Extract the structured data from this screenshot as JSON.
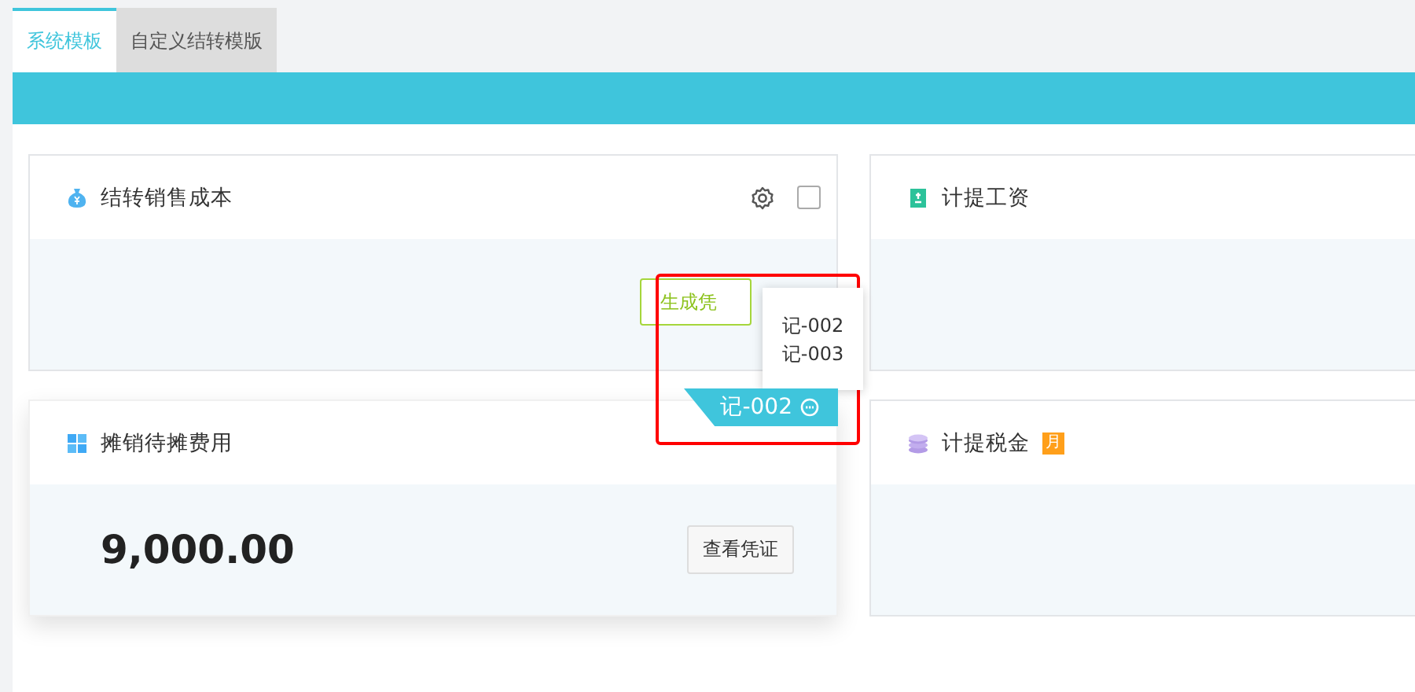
{
  "tabs": [
    {
      "label": "系统模板",
      "selected": true
    },
    {
      "label": "自定义结转模版",
      "selected": false
    }
  ],
  "cards": [
    {
      "kind": "action",
      "title": "结转销售成本",
      "checked": false,
      "button": "生成凭"
    },
    {
      "kind": "empty",
      "title": "计提工资"
    },
    {
      "kind": "amount",
      "title": "摊销待摊费用",
      "amount": "9,000.00",
      "button": "查看凭证"
    },
    {
      "kind": "empty",
      "title": "计提税金",
      "badge": "月"
    }
  ],
  "voucher_tag": {
    "label": "记-002",
    "menu": [
      "记-002",
      "记-003"
    ]
  }
}
